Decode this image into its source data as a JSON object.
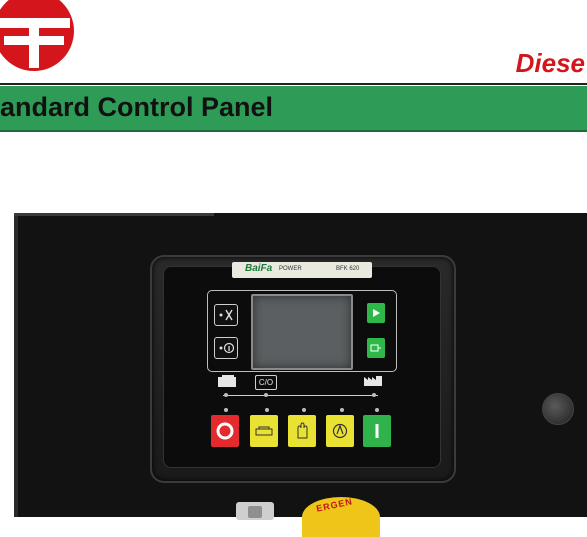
{
  "header": {
    "brand_text": "Diese",
    "band_title": "andard Control Panel"
  },
  "controller": {
    "brand_label": "BaiFa",
    "power_label": "POWER",
    "model_label": "BFK 620",
    "changeover_label": "C/O"
  },
  "estop": {
    "label": "ERGEN"
  },
  "colors": {
    "brand_red": "#d4161c",
    "band_green": "#2e9c57",
    "stop_red": "#e22a2f",
    "mode_yellow": "#e9e233",
    "start_green": "#31b34c"
  },
  "icons": {
    "logo": "company-logo",
    "buttons": [
      "stop-reset-icon",
      "manual-icon",
      "hand-icon",
      "auto-icon",
      "start-icon"
    ]
  }
}
